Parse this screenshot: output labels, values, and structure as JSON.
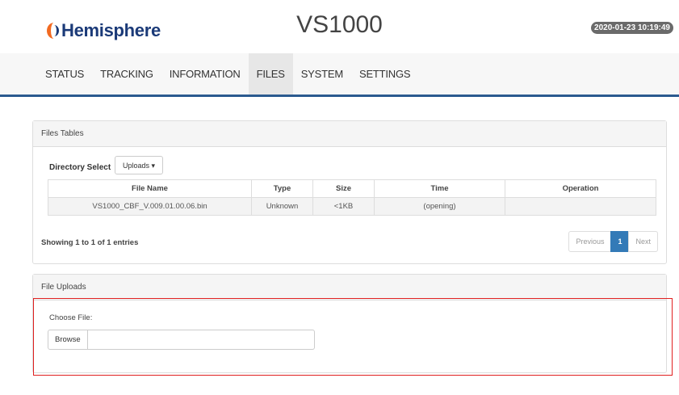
{
  "header": {
    "logo_text": "Hemisphere",
    "title": "VS1000",
    "timestamp": "2020-01-23 10:19:49"
  },
  "nav": {
    "items": [
      {
        "label": "STATUS"
      },
      {
        "label": "TRACKING"
      },
      {
        "label": "INFORMATION"
      },
      {
        "label": "FILES",
        "active": true
      },
      {
        "label": "SYSTEM"
      },
      {
        "label": "SETTINGS"
      }
    ]
  },
  "files_table": {
    "heading": "Files Tables",
    "directory_label": "Directory Select",
    "directory_value": "Uploads",
    "columns": [
      "File Name",
      "Type",
      "Size",
      "Time",
      "Operation"
    ],
    "rows": [
      [
        "VS1000_CBF_V.009.01.00.06.bin",
        "Unknown",
        "<1KB",
        "(opening)",
        ""
      ]
    ],
    "showing": "Showing 1 to 1 of 1 entries",
    "pagination": {
      "previous": "Previous",
      "current": "1",
      "next": "Next"
    }
  },
  "uploads": {
    "heading": "File Uploads",
    "choose_label": "Choose File:",
    "browse_label": "Browse"
  },
  "colors": {
    "brand_blue": "#1b3a78",
    "logo_orange": "#f26a21",
    "nav_border": "#2b5a8f",
    "pager_active": "#337ab7",
    "highlight_red": "#e02020"
  }
}
